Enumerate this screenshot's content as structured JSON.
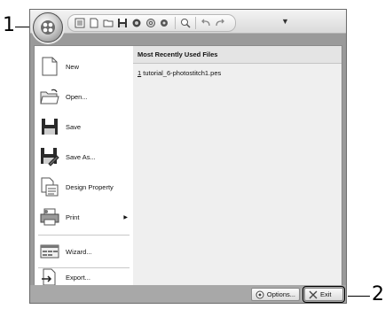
{
  "callouts": {
    "app_button": "1",
    "exit_button": "2"
  },
  "menu": {
    "items": [
      {
        "label": "New",
        "icon": "new-file-icon"
      },
      {
        "label": "Open...",
        "icon": "open-folder-icon"
      },
      {
        "label": "Save",
        "icon": "save-disk-icon"
      },
      {
        "label": "Save As...",
        "icon": "save-as-icon"
      },
      {
        "label": "Design Property",
        "icon": "design-property-icon"
      },
      {
        "label": "Print",
        "icon": "print-icon",
        "has_submenu": true
      },
      {
        "label": "Wizard...",
        "icon": "wizard-icon"
      },
      {
        "label": "Export...",
        "icon": "export-icon"
      }
    ]
  },
  "recent": {
    "header": "Most Recently Used Files",
    "files": [
      {
        "index": "1",
        "name": "tutorial_6-photostitch1.pes"
      }
    ]
  },
  "buttons": {
    "options": "Options...",
    "exit": "Exit"
  }
}
